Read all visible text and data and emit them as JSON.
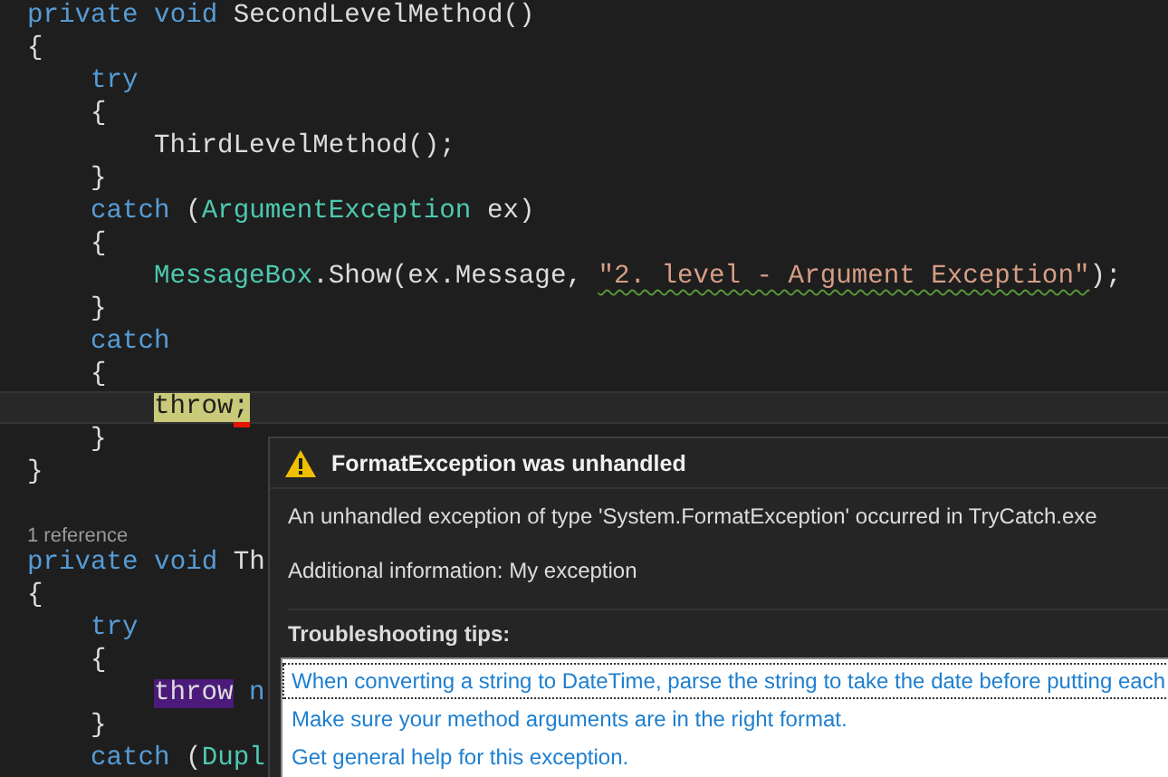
{
  "code_lines": [
    {
      "kind": "code",
      "current": false,
      "tokens": [
        {
          "text": "private void ",
          "kind": "keyword"
        },
        {
          "text": "SecondLevelMethod()",
          "kind": "plain"
        }
      ]
    },
    {
      "kind": "code",
      "current": false,
      "tokens": [
        {
          "text": "{",
          "kind": "plain"
        }
      ],
      "children": [
        {
          "kind": "code",
          "current": false,
          "tokens": [
            {
              "text": "try",
              "kind": "keyword"
            }
          ]
        },
        {
          "kind": "code",
          "current": false,
          "tokens": [
            {
              "text": "{",
              "kind": "plain"
            }
          ],
          "children": [
            {
              "kind": "code",
              "current": false,
              "tokens": [
                {
                  "text": "ThirdLevelMethod();",
                  "kind": "plain"
                }
              ]
            }
          ]
        },
        {
          "kind": "code",
          "current": false,
          "tokens": [
            {
              "text": "}",
              "kind": "plain"
            }
          ]
        },
        {
          "kind": "code",
          "current": false,
          "tokens": [
            {
              "text": "catch",
              "kind": "keyword"
            },
            {
              "text": " (",
              "kind": "plain"
            },
            {
              "text": "ArgumentException",
              "kind": "type"
            },
            {
              "text": " ex)",
              "kind": "plain"
            }
          ]
        },
        {
          "kind": "code",
          "current": false,
          "tokens": [
            {
              "text": "{",
              "kind": "plain"
            }
          ],
          "children": [
            {
              "kind": "code",
              "current": false,
              "tokens": [
                {
                  "text": "MessageBox",
                  "kind": "type"
                },
                {
                  "text": ".Show(ex.Message, ",
                  "kind": "plain"
                },
                {
                  "text": "\"2. level - Argument Exception\"",
                  "kind": "string"
                },
                {
                  "text": ");",
                  "kind": "plain"
                }
              ]
            }
          ]
        },
        {
          "kind": "code",
          "current": false,
          "tokens": [
            {
              "text": "}",
              "kind": "plain"
            }
          ]
        },
        {
          "kind": "code",
          "current": false,
          "tokens": [
            {
              "text": "catch",
              "kind": "keyword"
            }
          ]
        },
        {
          "kind": "code",
          "current": false,
          "tokens": [
            {
              "text": "{",
              "kind": "plain"
            }
          ],
          "children": [
            {
              "kind": "code",
              "current": true,
              "tokens": [
                {
                  "text": "throw;",
                  "kind": "exception"
                }
              ]
            }
          ]
        },
        {
          "kind": "code",
          "current": false,
          "tokens": [
            {
              "text": "}",
              "kind": "plain"
            }
          ]
        }
      ]
    },
    {
      "kind": "code",
      "current": false,
      "tokens": [
        {
          "text": "}",
          "kind": "plain"
        }
      ]
    },
    {
      "kind": "blank",
      "current": false
    },
    {
      "kind": "codelens",
      "current": false,
      "text": "1 reference"
    },
    {
      "kind": "code",
      "current": false,
      "tokens": [
        {
          "text": "private void ",
          "kind": "keyword"
        },
        {
          "text": "Th",
          "kind": "plain"
        }
      ]
    },
    {
      "kind": "code",
      "current": false,
      "tokens": [
        {
          "text": "{",
          "kind": "plain"
        }
      ],
      "children": [
        {
          "kind": "code",
          "current": false,
          "tokens": [
            {
              "text": "try",
              "kind": "keyword"
            }
          ]
        },
        {
          "kind": "code",
          "current": false,
          "tokens": [
            {
              "text": "{",
              "kind": "plain"
            }
          ],
          "children": [
            {
              "kind": "code",
              "current": false,
              "tokens": [
                {
                  "text": "throw",
                  "kind": "reference"
                },
                {
                  "text": " n",
                  "kind": "keyword"
                }
              ]
            }
          ]
        },
        {
          "kind": "code",
          "current": false,
          "tokens": [
            {
              "text": "}",
              "kind": "plain"
            }
          ]
        },
        {
          "kind": "code",
          "current": false,
          "tokens": [
            {
              "text": "catch",
              "kind": "keyword"
            },
            {
              "text": " (",
              "kind": "plain"
            },
            {
              "text": "Dupl",
              "kind": "type"
            }
          ]
        }
      ]
    }
  ],
  "exception_popup": {
    "title": "FormatException was unhandled",
    "message": "An unhandled exception of type 'System.FormatException' occurred in TryCatch.exe",
    "additional_info": "Additional information: My exception",
    "tips_heading": "Troubleshooting tips:",
    "tips": [
      {
        "text": "When converting a string to DateTime, parse the string to take the date before putting each",
        "selected": true
      },
      {
        "text": "Make sure your method arguments are in the right format.",
        "selected": false
      },
      {
        "text": "Get general help for this exception.",
        "selected": false
      }
    ]
  }
}
